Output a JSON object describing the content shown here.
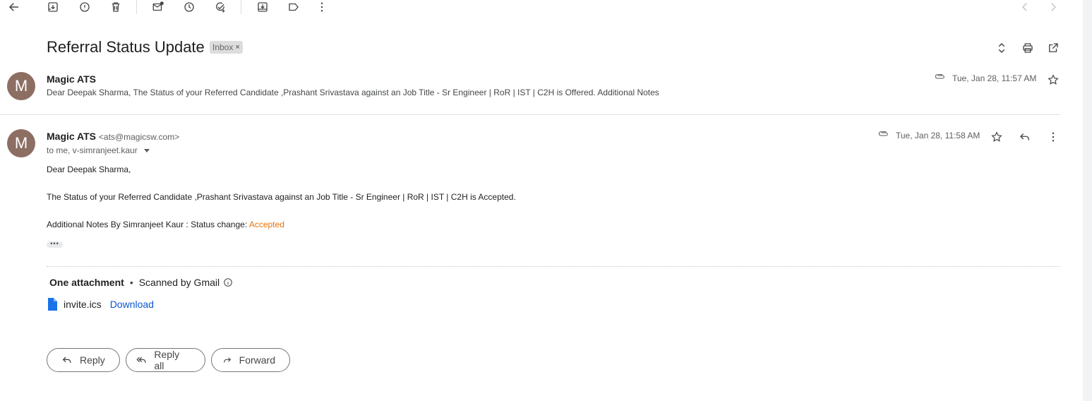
{
  "subject": {
    "title": "Referral Status Update",
    "label_chip": "Inbox",
    "label_remove": "×"
  },
  "collapsed_message": {
    "avatar_letter": "M",
    "sender_name": "Magic ATS",
    "date": "Tue, Jan 28, 11:57 AM",
    "snippet": "Dear Deepak Sharma, The Status of your Referred Candidate ,Prashant Srivastava against an Job Title - Sr Engineer | RoR | IST | C2H is Offered. Additional Notes"
  },
  "expanded_message": {
    "avatar_letter": "M",
    "sender_name": "Magic ATS",
    "sender_email": "<ats@magicsw.com>",
    "to_line": "to me, v-simranjeet.kaur",
    "date": "Tue, Jan 28, 11:58 AM",
    "greeting": "Dear Deepak Sharma,",
    "body_line": "The Status of your Referred Candidate ,Prashant Srivastava against an Job Title - Sr Engineer | RoR | IST | C2H is Accepted.",
    "notes_prefix": "Additional Notes By Simranjeet Kaur : Status change: ",
    "notes_status": "Accepted",
    "trimmed_content": "•••"
  },
  "attachments": {
    "header": "One attachment",
    "separator": "•",
    "scan_note": "Scanned by Gmail",
    "file_name": "invite.ics",
    "download_label": "Download"
  },
  "actions": {
    "reply": "Reply",
    "reply_all": "Reply all",
    "forward": "Forward"
  },
  "colors": {
    "accent_link": "#0b57d0",
    "status_accepted": "#e8710a",
    "avatar_bg": "#8d6e63",
    "file_icon": "#1a73e8"
  }
}
